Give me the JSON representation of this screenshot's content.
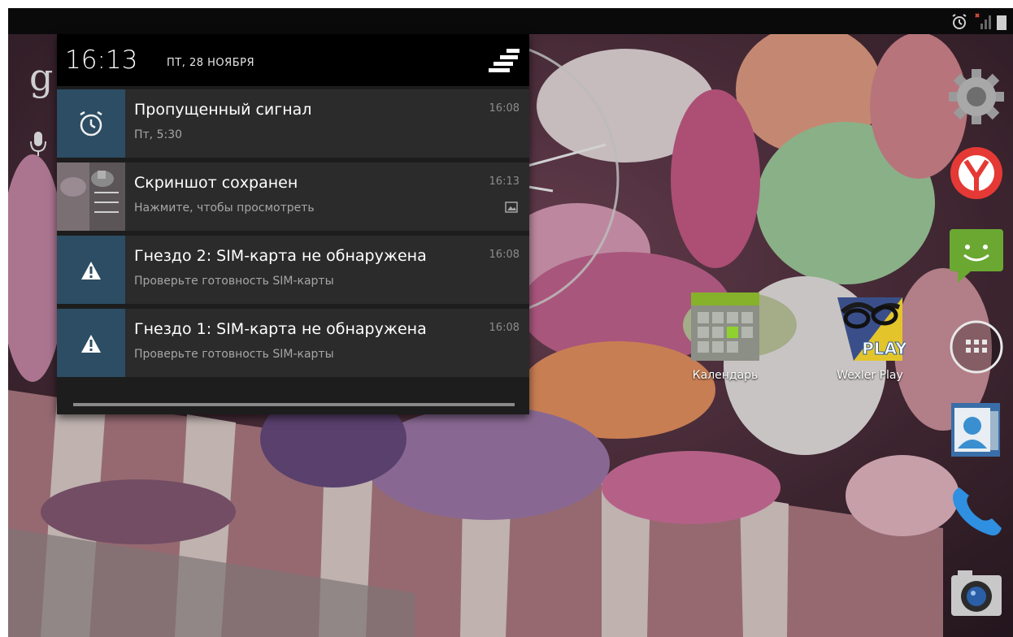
{
  "shade": {
    "clock_time": "16:13",
    "clock_date": "ПТ, 28 НОЯБРЯ",
    "notifications": [
      {
        "title": "Пропущенный сигнал",
        "subtitle": "Пт, 5:30",
        "time": "16:08",
        "icon": "alarm-icon"
      },
      {
        "title": "Скриншот сохранен",
        "subtitle": "Нажмите, чтобы просмотреть",
        "time": "16:13",
        "icon": "screenshot-thumbnail"
      },
      {
        "title": "Гнездо 2: SIM-карта не обнаружена",
        "subtitle": "Проверьте готовность SIM-карты",
        "time": "16:08",
        "icon": "warning-icon"
      },
      {
        "title": "Гнездо 1: SIM-карта не обнаружена",
        "subtitle": "Проверьте готовность SIM-карты",
        "time": "16:08",
        "icon": "warning-icon"
      }
    ]
  },
  "desktop": {
    "apps": [
      {
        "label": "Календарь",
        "icon": "calendar-icon"
      },
      {
        "label": "Wexler Play",
        "icon": "wexler-play-icon",
        "badge": "PLAY"
      }
    ]
  },
  "dock": [
    "settings-icon",
    "yandex-browser-icon",
    "messaging-icon",
    "app-drawer-icon",
    "contacts-icon",
    "phone-icon",
    "camera-icon"
  ],
  "colors": {
    "notif_icon_bg": "#2c4d63",
    "shade_bg": "#1d1d1d",
    "header_bg": "#000000"
  }
}
